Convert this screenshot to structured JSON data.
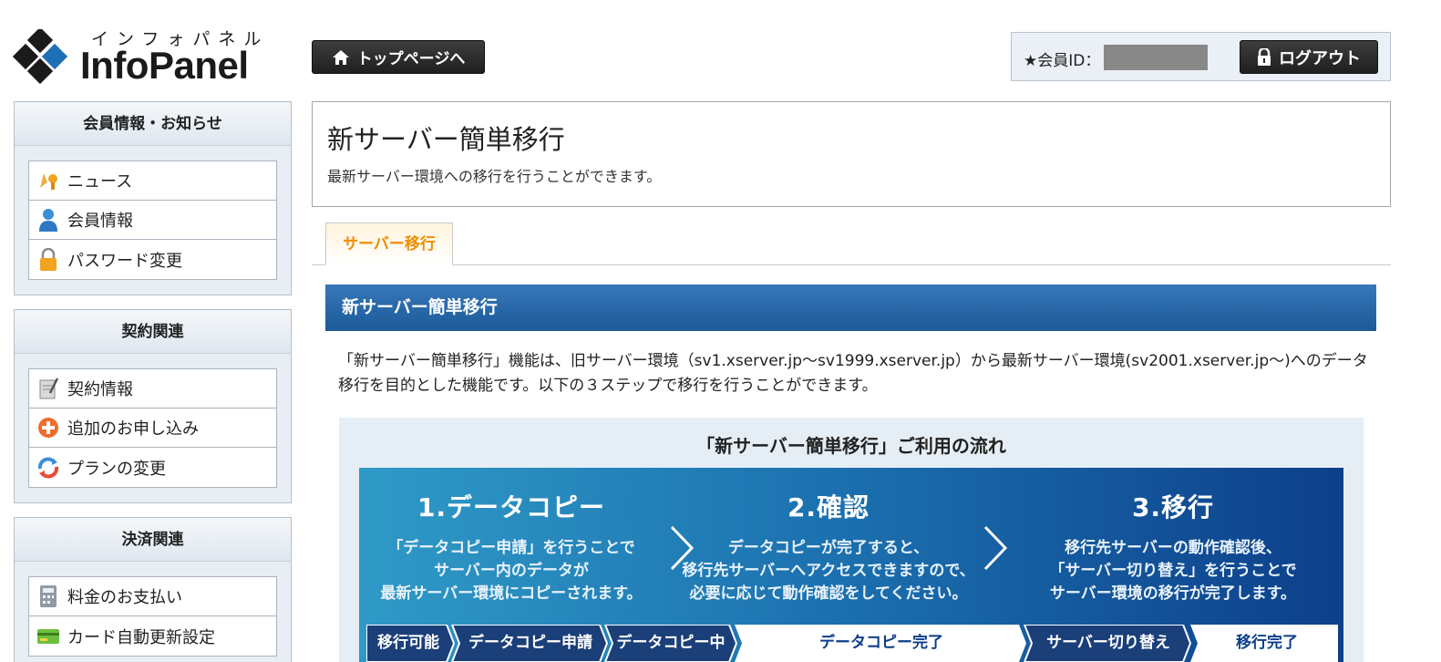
{
  "logo": {
    "kana": "インフォパネル",
    "word": "InfoPanel"
  },
  "header": {
    "top_button": "トップページへ",
    "member_label": "★会員ID：",
    "logout_button": "ログアウト"
  },
  "sidebar": {
    "panels": [
      {
        "title": "会員情報・お知らせ",
        "items": [
          {
            "label": "ニュース",
            "icon": "news-icon"
          },
          {
            "label": "会員情報",
            "icon": "user-icon"
          },
          {
            "label": "パスワード変更",
            "icon": "lock-icon"
          }
        ]
      },
      {
        "title": "契約関連",
        "items": [
          {
            "label": "契約情報",
            "icon": "contract-icon"
          },
          {
            "label": "追加のお申し込み",
            "icon": "add-icon"
          },
          {
            "label": "プランの変更",
            "icon": "refresh-icon"
          }
        ]
      },
      {
        "title": "決済関連",
        "items": [
          {
            "label": "料金のお支払い",
            "icon": "calculator-icon"
          },
          {
            "label": "カード自動更新設定",
            "icon": "card-icon"
          }
        ]
      }
    ]
  },
  "main": {
    "title": "新サーバー簡単移行",
    "description": "最新サーバー環境への移行を行うことができます。",
    "tab": "サーバー移行",
    "section_title": "新サーバー簡単移行",
    "intro": "「新サーバー簡単移行」機能は、旧サーバー環境（sv1.xserver.jp～sv1999.xserver.jp）から最新サーバー環境(sv2001.xserver.jp～)へのデータ移行を目的とした機能です。以下の３ステップで移行を行うことができます。"
  },
  "flow": {
    "title": "「新サーバー簡単移行」ご利用の流れ",
    "steps": [
      {
        "title": "1.データコピー",
        "lines": [
          "「データコピー申請」を行うことで",
          "サーバー内のデータが",
          "最新サーバー環境にコピーされます。"
        ]
      },
      {
        "title": "2.確認",
        "lines": [
          "データコピーが完了すると、",
          "移行先サーバーへアクセスできますので、",
          "必要に応じて動作確認をしてください。"
        ]
      },
      {
        "title": "3.移行",
        "lines": [
          "移行先サーバーの動作確認後、",
          "「サーバー切り替え」を行うことで",
          "サーバー環境の移行が完了します。"
        ]
      }
    ],
    "statuses": [
      "移行可能",
      "データコピー申請",
      "データコピー中",
      "データコピー完了",
      "サーバー切り替え",
      "移行完了"
    ]
  },
  "colors": {
    "accent_orange": "#f08c00",
    "section_blue": "#1c5a99",
    "flow_dark": "#0d3f8a"
  }
}
